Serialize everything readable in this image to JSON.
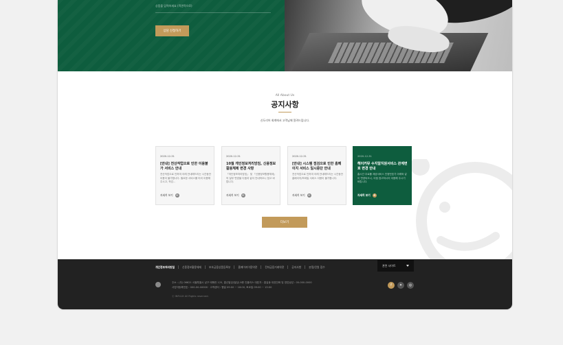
{
  "hero": {
    "input_hint": "상품을 입력하세요 (객관적으로)",
    "cta_label": "상담 신청하기"
  },
  "about": {
    "subtitle": "All About Us",
    "title": "공지사항",
    "description": "신도리어 회계에서 고객님께 알려드립니다."
  },
  "notices": [
    {
      "date": "2020-12-31",
      "title": "[안내] 전산작업으로 인한 이용불가 서비스 안내",
      "text": "전산작업으로 인하여 아래 안내해드리는 시간동안 이용이 불가합니다. 필요한 서비스를 미리 이용해주시고, 작업…",
      "more": "자세히 보기"
    },
    {
      "date": "2020-12-31",
      "title": "10월 개인정보처리방침, 신용정보활용체제 변경 사항",
      "text": "「개인정보처리방침」 및 「신용정보활용체제」 의 일부 변경을 다음과 같이 안내하오니 참고 바랍니다.",
      "more": "자세히 보기"
    },
    {
      "date": "2020-12-31",
      "title": "[안내] 시스템 점검으로 인한 홈페이지 서비스 일시중단 안내",
      "text": "전산작업으로 인하여 아래 안내해드리는 시간동안 홈페이지/모바일 서비스 이용이 불가합니다.",
      "more": "자세히 보기"
    },
    {
      "date": "2020-12-31",
      "title": "헤이커뮤 수지알지원서비스 관계변호 변경 안내",
      "text": "홈시간 무료를 제공서비스 인정번호가 아래와 같이 변경되오니, 이점 참고하시어 이용해 주시기 바랍니다.",
      "more": "자세히 보기"
    }
  ],
  "more_button": "더보기",
  "footer": {
    "nav": [
      "개인정보처리방침",
      "신용정보활용체제",
      "보호금융상품등록부",
      "홈페이지이용약관",
      "전자금융거래약관",
      "공지사항",
      "분쟁/민원 접수"
    ],
    "family_site": "관련 사이트",
    "address_line1": "주소 : (우) 06621 서울특별시 남구 테헤란 125, 홍신빌딩(빌딩) 8층 인플리스    대표자 : 홍길동    대표전화 및 영업상담 : 00-000-0000",
    "address_line2": "사업자등록번호 : 000-00-00000  ·  고객센터 : 평일 09:00 ~ 18:00, 토요일 09:00 ~ 13:00",
    "copyright": "ⓒ INFLUX All Rights reserved."
  },
  "colors": {
    "brand_green": "#0e5d3e",
    "accent_gold": "#c29a5a",
    "footer_bg": "#222222"
  },
  "icons": {
    "more": "plus-circle-icon",
    "social": [
      "facebook-icon",
      "twitter-icon",
      "instagram-icon"
    ]
  }
}
